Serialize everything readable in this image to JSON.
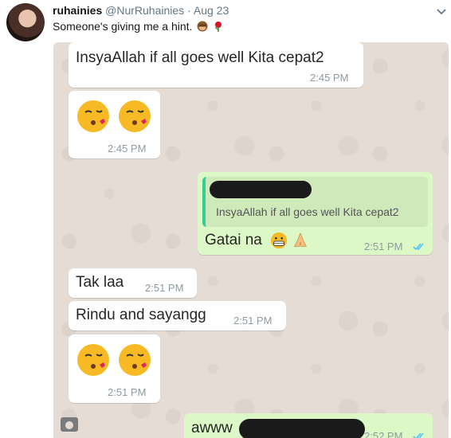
{
  "tweet": {
    "display_name": "ruhainies",
    "handle": "@NurRuhainies",
    "separator": "·",
    "date": "Aug 23",
    "text": "Someone's giving me a hint.",
    "emoji_icons": [
      "see-no-evil-monkey-icon",
      "rose-icon"
    ]
  },
  "chat": {
    "messages": [
      {
        "type": "incoming",
        "text": "InsyaAllah if all goes well Kita cepat2",
        "time": "2:45 PM"
      },
      {
        "type": "incoming",
        "emoji_icons": [
          "kissing-face-icon",
          "kissing-face-icon"
        ],
        "time": "2:45 PM"
      },
      {
        "type": "outgoing",
        "quoted_text": "InsyaAllah if all goes well Kita cepat2",
        "text": "Gatai na",
        "emoji_icons": [
          "grimacing-face-icon",
          "folded-hands-icon"
        ],
        "time": "2:51 PM",
        "status": "read-ticks"
      },
      {
        "type": "incoming",
        "text": "Tak laa",
        "time": "2:51 PM"
      },
      {
        "type": "incoming",
        "text": "Rindu and sayangg",
        "time": "2:51 PM"
      },
      {
        "type": "incoming",
        "emoji_icons": [
          "kissing-face-icon",
          "kissing-face-icon"
        ],
        "time": "2:51 PM"
      },
      {
        "type": "outgoing",
        "text": "awww",
        "time": "2:52 PM",
        "status": "read-ticks"
      }
    ]
  },
  "colors": {
    "chat_bg": "#e5ddd5",
    "incoming_bubble": "#ffffff",
    "outgoing_bubble": "#dcf8c6",
    "read_ticks": "#4fc3f7",
    "quote_bar": "#35cd96"
  }
}
